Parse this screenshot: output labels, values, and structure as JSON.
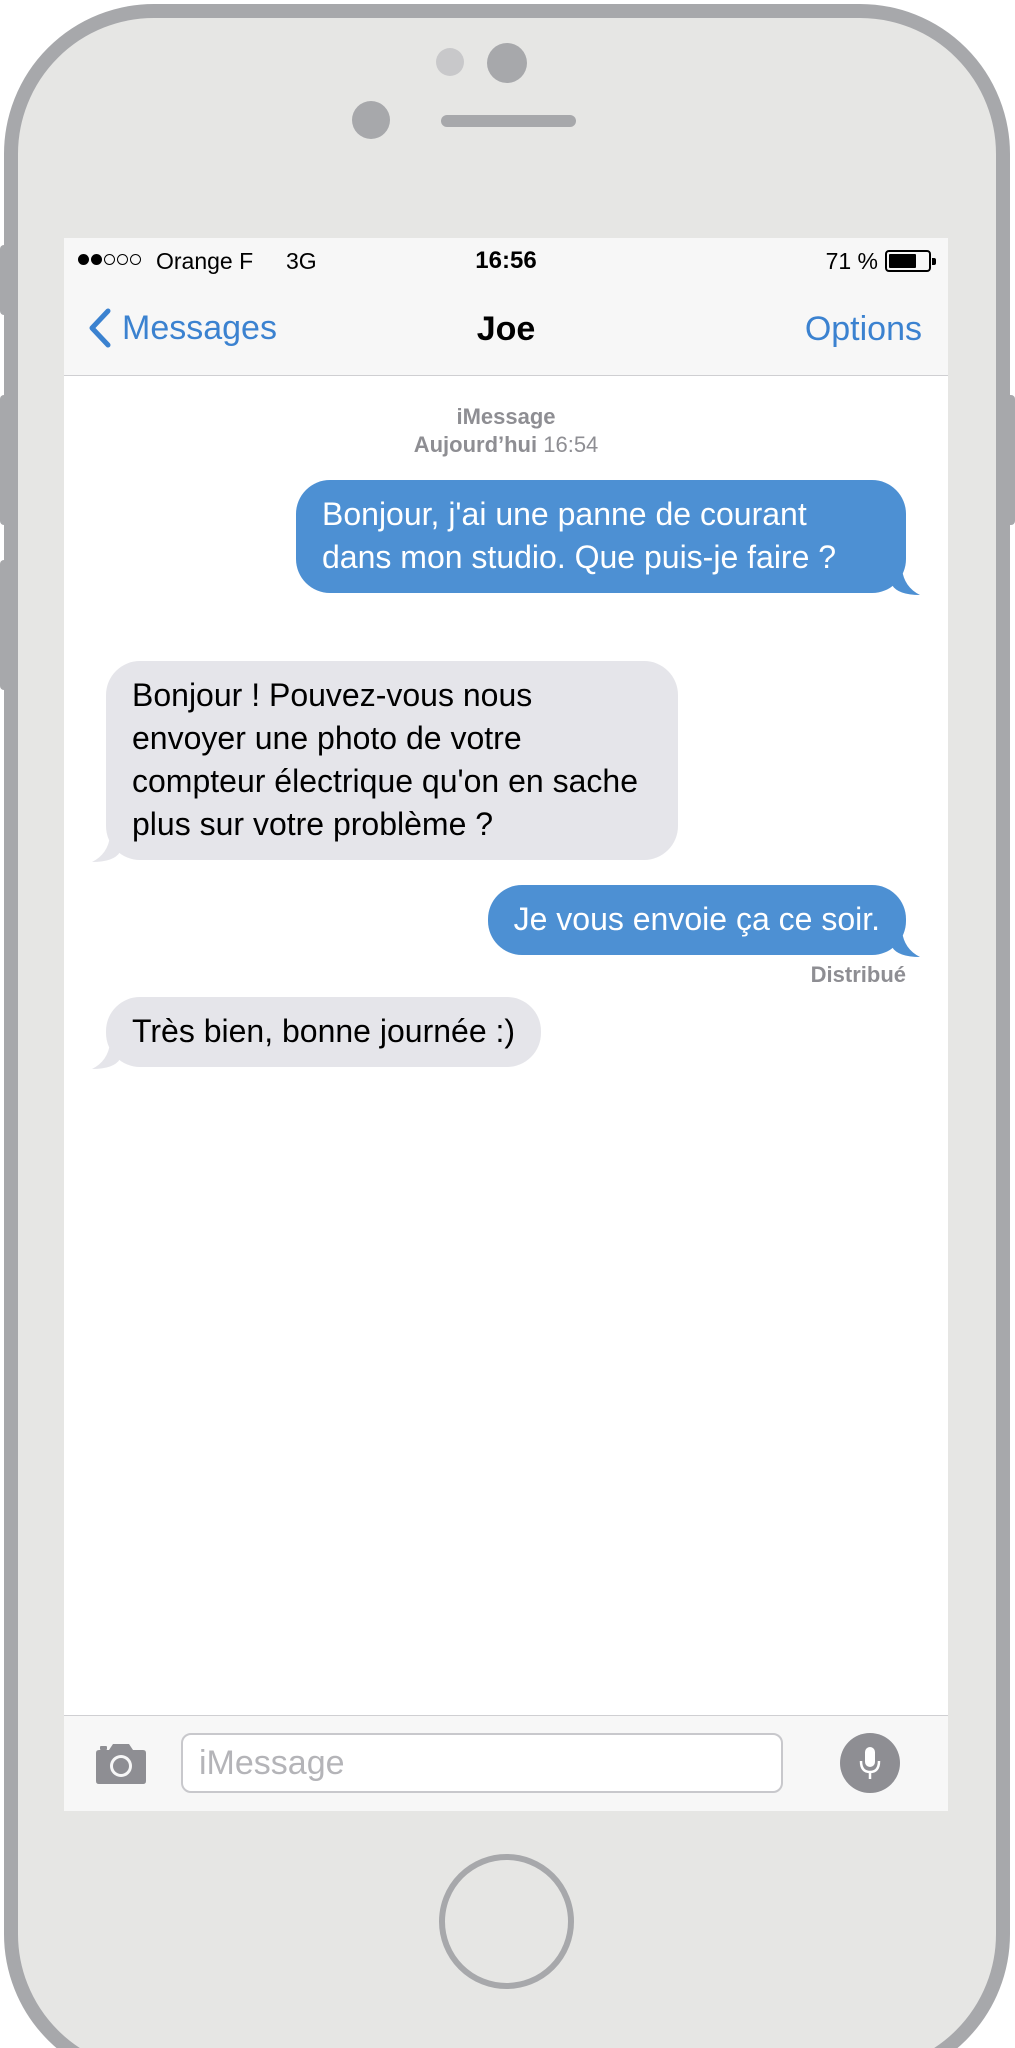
{
  "status_bar": {
    "signal_strength": 2,
    "signal_total": 5,
    "carrier": "Orange F",
    "network": "3G",
    "time": "16:56",
    "battery_pct_label": "71 %",
    "battery_level": 0.71
  },
  "nav": {
    "back_label": "Messages",
    "title": "Joe",
    "options_label": "Options"
  },
  "conversation": {
    "service_label": "iMessage",
    "date_label": "Aujourd’hui",
    "date_time": "16:54",
    "messages": [
      {
        "direction": "outgoing",
        "text": "Bonjour, j'ai une panne de courant dans mon studio. Que puis-je faire ?"
      },
      {
        "direction": "incoming",
        "text": "Bonjour ! Pouvez-vous nous envoyer une photo de votre compteur électrique qu'on en sache plus sur votre problème ?"
      },
      {
        "direction": "outgoing",
        "text": "Je vous envoie ça ce soir."
      },
      {
        "direction": "incoming",
        "text": "Très bien, bonne journée :)"
      }
    ],
    "delivered_label": "Distribué"
  },
  "input_bar": {
    "camera_icon": "camera-icon",
    "placeholder": "iMessage",
    "mic_icon": "microphone-icon"
  },
  "colors": {
    "accent": "#3b82d0",
    "outgoing_bubble": "#4d90d3",
    "incoming_bubble": "#e5e5ea",
    "phone_frame": "#a7a8ab"
  }
}
